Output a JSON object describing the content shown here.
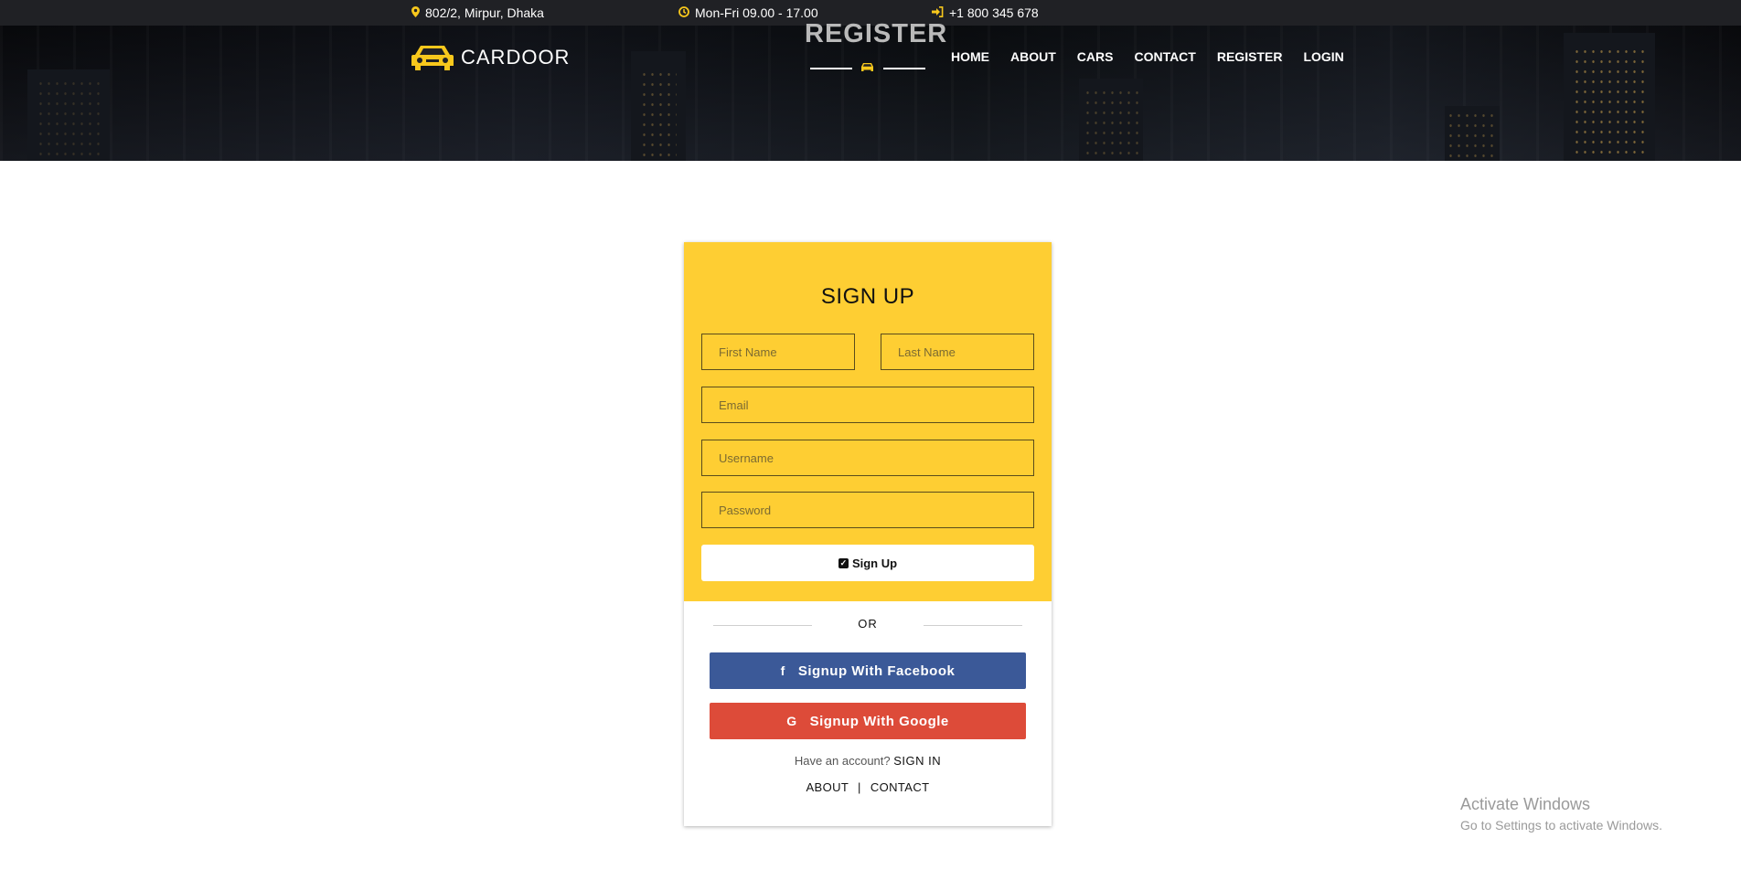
{
  "topbar": {
    "address": "802/2, Mirpur, Dhaka",
    "hours": "Mon-Fri 09.00 - 17.00",
    "phone": "+1 800 345 678",
    "icons": [
      "map-marker-icon",
      "clock-icon",
      "sign-in-icon"
    ],
    "accent": "#f8c81c"
  },
  "header": {
    "brand": "CARDOOR",
    "page_title": "REGISTER",
    "nav": [
      "HOME",
      "ABOUT",
      "CARS",
      "CONTACT",
      "REGISTER",
      "LOGIN"
    ]
  },
  "form": {
    "heading": "SIGN UP",
    "first_name_placeholder": "First Name",
    "last_name_placeholder": "Last Name",
    "email_placeholder": "Email",
    "username_placeholder": "Username",
    "password_placeholder": "Password",
    "submit_label": "Sign Up",
    "background": "#fece33"
  },
  "social": {
    "or_label": "OR",
    "facebook_label": "Signup With Facebook",
    "facebook_icon": "f",
    "facebook_color": "#3b5998",
    "google_label": "Signup With Google",
    "google_icon": "G",
    "google_color": "#dd4b39"
  },
  "footer_links": {
    "have_account": "Have an account?",
    "sign_in": "SIGN IN",
    "about": "ABOUT",
    "separator": "|",
    "contact": "CONTACT"
  },
  "watermark": {
    "line1": "Activate Windows",
    "line2": "Go to Settings to activate Windows."
  }
}
